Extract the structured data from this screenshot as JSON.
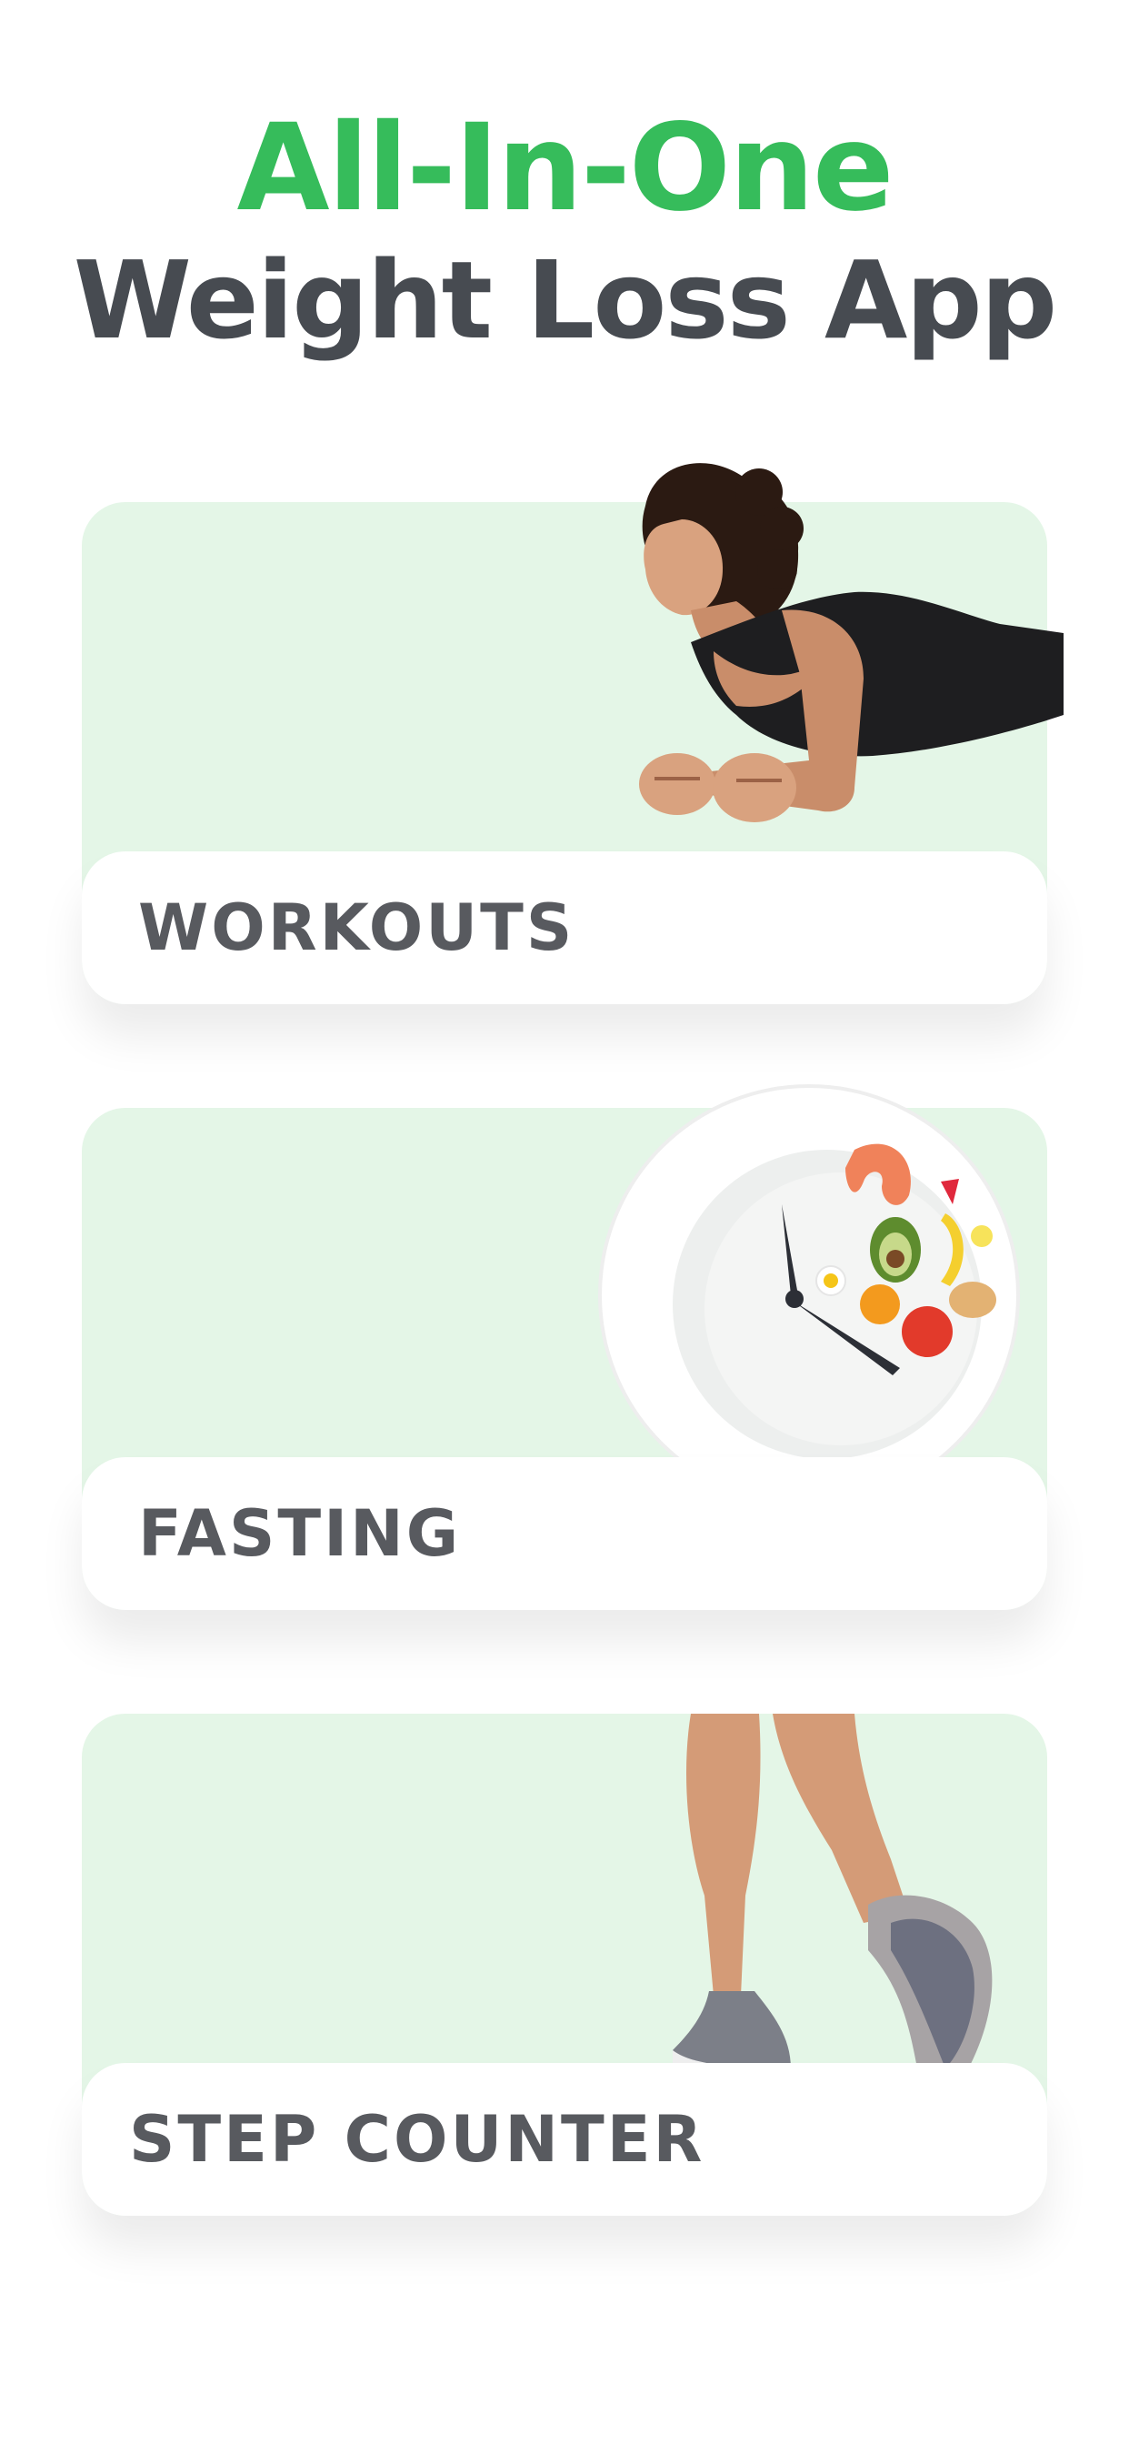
{
  "header": {
    "line1": "All-In-One",
    "line2": "Weight Loss App"
  },
  "cards": [
    {
      "label": "WORKOUTS",
      "icon": "woman-plank-illustration"
    },
    {
      "label": "FASTING",
      "icon": "fasting-plate-clock-illustration"
    },
    {
      "label": "STEP COUNTER",
      "icon": "walking-legs-illustration"
    }
  ],
  "colors": {
    "accent": "#36BC5B",
    "headline": "#474B51",
    "card_bg": "#E4F6E7",
    "label": "#585A5F"
  }
}
